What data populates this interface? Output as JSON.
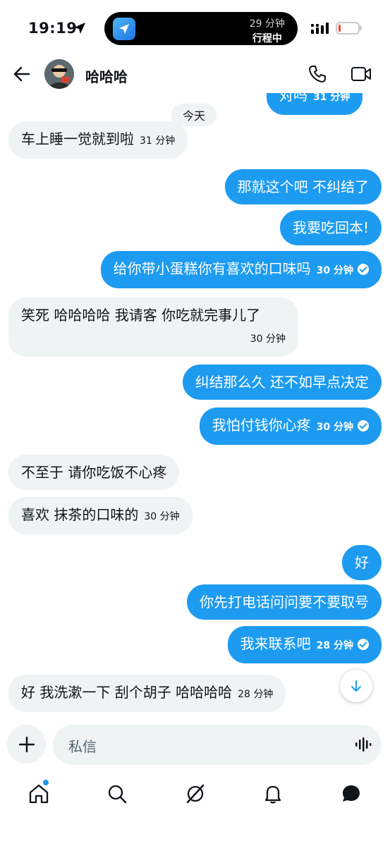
{
  "status_bar": {
    "time": "19:19",
    "eta_minutes": "29 分钟",
    "eta_label": "行程中",
    "battery_level": 0.1,
    "battery_color": "#ff3b30"
  },
  "header": {
    "contact_name": "哈哈哈"
  },
  "chat": {
    "date_divider": "今天",
    "messages": [
      {
        "dir": "out",
        "text": "对吗",
        "time": "31 分钟",
        "partial": true
      },
      {
        "dir": "in",
        "text": "车上睡一觉就到啦",
        "time": "31 分钟"
      },
      {
        "dir": "out",
        "text": "那就这个吧 不纠结了"
      },
      {
        "dir": "out",
        "text": "我要吃回本!"
      },
      {
        "dir": "out",
        "text": "给你带小蛋糕你有喜欢的口味吗",
        "time": "30 分钟"
      },
      {
        "dir": "in",
        "text": "笑死 哈哈哈哈 我请客 你吃就完事儿了",
        "time": "30 分钟"
      },
      {
        "dir": "out",
        "text": "纠结那么久 还不如早点决定"
      },
      {
        "dir": "out",
        "text": "我怕付钱你心疼",
        "time": "30 分钟"
      },
      {
        "dir": "in",
        "text": "不至于 请你吃饭不心疼"
      },
      {
        "dir": "in",
        "text": "喜欢 抹茶的口味的",
        "time": "30 分钟"
      },
      {
        "dir": "out",
        "text": "好"
      },
      {
        "dir": "out",
        "text": "你先打电话问问要不要取号"
      },
      {
        "dir": "out",
        "text": "我来联系吧",
        "time": "28 分钟"
      },
      {
        "dir": "in",
        "text": "好 我洗漱一下 刮个胡子 哈哈哈哈",
        "time": "28 分钟"
      }
    ]
  },
  "composer": {
    "placeholder": "私信"
  },
  "colors": {
    "accent": "#1d9bf0",
    "incoming_bubble": "#eff3f4"
  }
}
